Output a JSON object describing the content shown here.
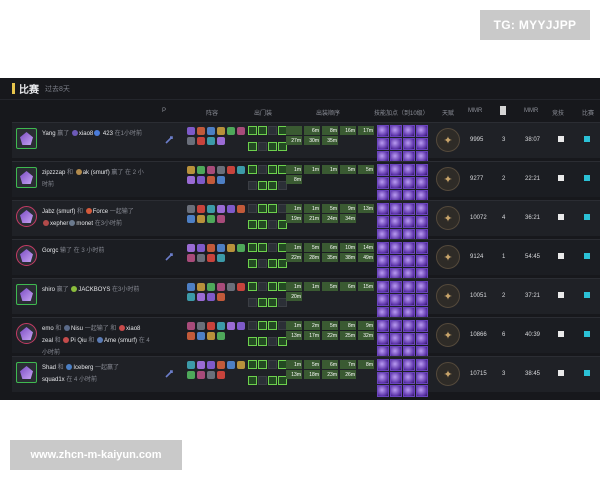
{
  "watermark_top": "TG: MYYJJPP",
  "watermark_bottom": "www.zhcn-m-kaiyun.com",
  "panel": {
    "title": "比赛",
    "subtitle": "过去8天"
  },
  "columns": [
    "P",
    "阵容",
    "出门装",
    "出装顺序",
    "技能加点（到10级）",
    "天赋",
    "MMR",
    "",
    "MMR",
    "竞技",
    "比赛"
  ],
  "rows": [
    {
      "frame": "green",
      "line1": [
        {
          "t": "Yang",
          "c": "name"
        },
        {
          "t": " 赢了 ",
          "c": "muted"
        },
        {
          "t": "xiao8",
          "c": "name",
          "dot": "#6c59b7"
        },
        {
          "t": " 423",
          "c": "name",
          "dot": "#4a7bd9"
        },
        {
          "t": " 在1小时前",
          "c": "muted"
        }
      ],
      "line2": [],
      "pin": true,
      "mmr": "9995",
      "n": "3",
      "dur": "38:07",
      "times": [
        "",
        "6m",
        "8m",
        "16m",
        "17m",
        "27m",
        "30m",
        "35m"
      ]
    },
    {
      "frame": "green",
      "line1": [
        {
          "t": "zipzzzap",
          "c": "name"
        },
        {
          "t": " 和 ",
          "c": "muted"
        },
        {
          "t": "ak (smurf)",
          "c": "name",
          "dot": "#b18a4c"
        },
        {
          "t": " 赢了 在 2 小",
          "c": "muted"
        }
      ],
      "line2": [
        {
          "t": "时前",
          "c": "muted"
        }
      ],
      "pin": false,
      "mmr": "9277",
      "n": "2",
      "dur": "22:21",
      "times": [
        "1m",
        "1m",
        "1m",
        "5m",
        "5m",
        "8m"
      ]
    },
    {
      "frame": "red",
      "line1": [
        {
          "t": "Jabz (smurf)",
          "c": "name"
        },
        {
          "t": " 和 ",
          "c": "muted"
        },
        {
          "t": "Force",
          "c": "name",
          "dot": "#d45a3b"
        },
        {
          "t": " 一起输了",
          "c": "muted"
        }
      ],
      "line2": [
        {
          "t": "xepher",
          "c": "name",
          "dot": "#b24a4a"
        },
        {
          "t": "monet",
          "c": "name",
          "dot": "#6b7a8e"
        },
        {
          "t": " 在3小时前",
          "c": "muted"
        }
      ],
      "pin": false,
      "mmr": "10072",
      "n": "4",
      "dur": "36:21",
      "times": [
        "1m",
        "1m",
        "5m",
        "9m",
        "13m",
        "19m",
        "21m",
        "24m",
        "34m"
      ]
    },
    {
      "frame": "red",
      "line1": [
        {
          "t": "Gorgc",
          "c": "name"
        },
        {
          "t": " 输了 在 3 小时前",
          "c": "muted"
        }
      ],
      "line2": [],
      "pin": true,
      "mmr": "9124",
      "n": "1",
      "dur": "54:45",
      "times": [
        "1m",
        "5m",
        "6m",
        "10m",
        "14m",
        "22m",
        "28m",
        "35m",
        "38m",
        "49m"
      ]
    },
    {
      "frame": "green",
      "line1": [
        {
          "t": "shiro",
          "c": "name"
        },
        {
          "t": " 赢了 ",
          "c": "muted"
        },
        {
          "t": "JACKBOYS",
          "c": "name",
          "dot": "#8bbd3c"
        },
        {
          "t": " 在3小时前",
          "c": "muted"
        }
      ],
      "line2": [],
      "pin": false,
      "mmr": "10051",
      "n": "2",
      "dur": "37:21",
      "times": [
        "1m",
        "1m",
        "5m",
        "6m",
        "15m",
        "20m"
      ]
    },
    {
      "frame": "red",
      "line1": [
        {
          "t": "emo",
          "c": "name"
        },
        {
          "t": " 和 ",
          "c": "muted"
        },
        {
          "t": "Nisu",
          "c": "name",
          "dot": "#5b6b8a"
        },
        {
          "t": " 一起输了 和 ",
          "c": "muted"
        },
        {
          "t": "xiao8",
          "c": "name",
          "dot": "#c84a4a"
        }
      ],
      "line2": [
        {
          "t": "zeal",
          "c": "name"
        },
        {
          "t": " 和 ",
          "c": "muted"
        },
        {
          "t": "Pi Qiu",
          "c": "name",
          "dot": "#c44b4b"
        },
        {
          "t": " 和 ",
          "c": "muted"
        },
        {
          "t": "Ame (smurf)",
          "c": "name",
          "dot": "#5a7bb5"
        },
        {
          "t": " 在 4",
          "c": "muted"
        }
      ],
      "line3": [
        {
          "t": "小时前",
          "c": "muted"
        }
      ],
      "pin": false,
      "mmr": "10866",
      "n": "6",
      "dur": "40:39",
      "times": [
        "1m",
        "2m",
        "5m",
        "8m",
        "9m",
        "13m",
        "17m",
        "22m",
        "25m",
        "32m"
      ]
    },
    {
      "frame": "green",
      "line1": [
        {
          "t": "Shad",
          "c": "name"
        },
        {
          "t": " 和 ",
          "c": "muted"
        },
        {
          "t": "Iceberg",
          "c": "name",
          "dot": "#4b7fc4"
        },
        {
          "t": " 一起赢了",
          "c": "muted"
        }
      ],
      "line2": [
        {
          "t": "squad1x",
          "c": "name"
        },
        {
          "t": " 在 4 小时前",
          "c": "muted"
        }
      ],
      "pin": true,
      "mmr": "10715",
      "n": "3",
      "dur": "38:45",
      "times": [
        "1m",
        "5m",
        "6m",
        "7m",
        "8m",
        "13m",
        "18m",
        "23m",
        "26m"
      ]
    }
  ]
}
